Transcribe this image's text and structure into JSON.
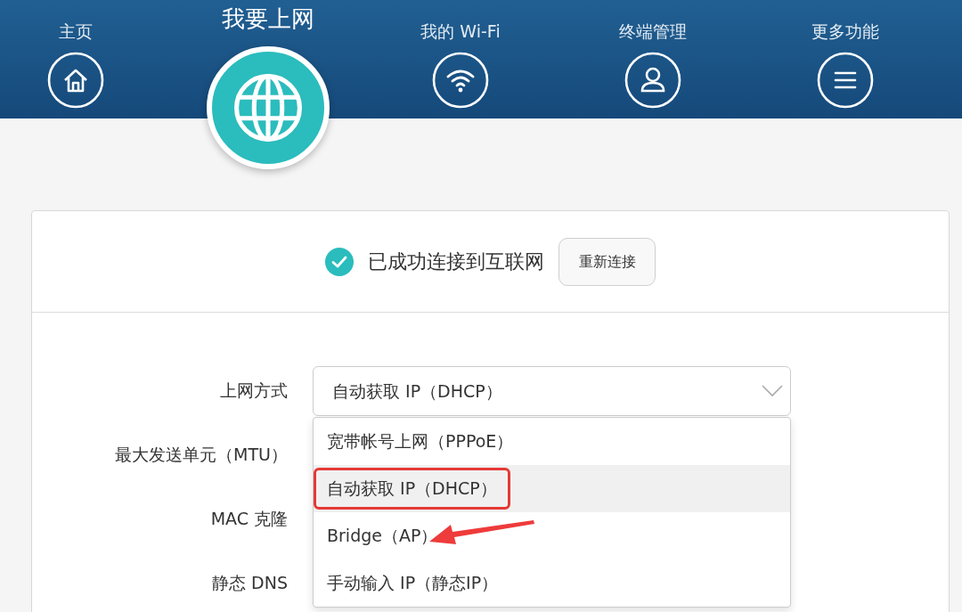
{
  "nav": [
    {
      "label": "主页",
      "kind": "home",
      "selected": false
    },
    {
      "label": "我要上网",
      "kind": "globe",
      "selected": true
    },
    {
      "label": "我的 Wi-Fi",
      "kind": "wifi",
      "selected": false
    },
    {
      "label": "终端管理",
      "kind": "user",
      "selected": false
    },
    {
      "label": "更多功能",
      "kind": "menu",
      "selected": false
    }
  ],
  "status": {
    "connected": true,
    "text": "已成功连接到互联网",
    "button": "重新连接"
  },
  "form": {
    "rows": [
      {
        "label": "上网方式"
      },
      {
        "label": "最大发送单元（MTU）"
      },
      {
        "label": "MAC 克隆"
      },
      {
        "label": "静态 DNS"
      }
    ],
    "select": {
      "value": "自动获取 IP（DHCP）",
      "expanded": true,
      "options": [
        {
          "label": "宽带帐号上网（PPPoE）",
          "selected": false,
          "highlighted": false,
          "pointed": false
        },
        {
          "label": "自动获取 IP（DHCP）",
          "selected": true,
          "highlighted": true,
          "pointed": false
        },
        {
          "label": "Bridge（AP）",
          "selected": false,
          "highlighted": false,
          "pointed": true
        },
        {
          "label": "手动输入 IP（静态IP）",
          "selected": false,
          "highlighted": false,
          "pointed": false
        }
      ]
    }
  }
}
